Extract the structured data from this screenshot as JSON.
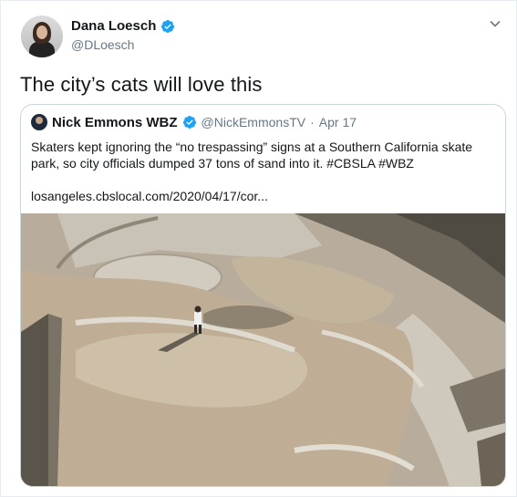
{
  "author": {
    "name": "Dana Loesch",
    "handle": "@DLoesch"
  },
  "tweet": {
    "text": "The city’s cats will love this"
  },
  "quoted": {
    "name": "Nick Emmons WBZ",
    "handle": "@NickEmmonsTV",
    "separator": "·",
    "date": "Apr 17",
    "text": "Skaters kept ignoring the “no trespassing” signs at a Southern California skate park, so city officials dumped 37 tons of sand into it. #CBSLA #WBZ",
    "link": "losangeles.cbslocal.com/2020/04/17/cor..."
  },
  "icons": {
    "verified": "verified-badge-icon",
    "menu": "chevron-down-icon"
  },
  "colors": {
    "verified": "#1da1f2",
    "secondary_text": "#657786",
    "border": "#ccd6dd"
  }
}
